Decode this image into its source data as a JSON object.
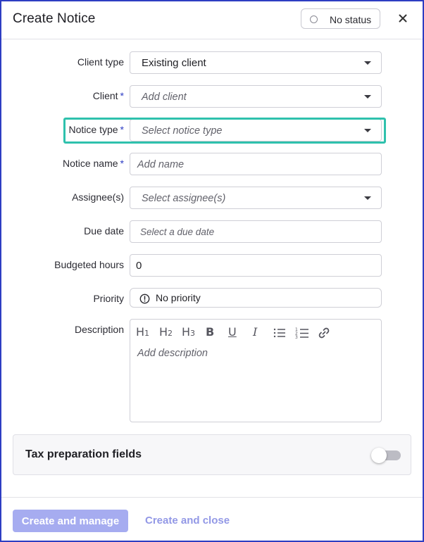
{
  "dialog": {
    "title": "Create Notice",
    "status_label": "No status",
    "close_icon": "close-icon"
  },
  "form": {
    "client_type": {
      "label": "Client type",
      "value": "Existing client"
    },
    "client": {
      "label": "Client",
      "required": "*",
      "placeholder": "Add client"
    },
    "notice_type": {
      "label": "Notice type",
      "required": "*",
      "placeholder": "Select notice type"
    },
    "notice_name": {
      "label": "Notice name",
      "required": "*",
      "placeholder": "Add name"
    },
    "assignees": {
      "label": "Assignee(s)",
      "placeholder": "Select assignee(s)"
    },
    "due_date": {
      "label": "Due date",
      "placeholder": "Select a due date"
    },
    "budgeted_hours": {
      "label": "Budgeted hours",
      "value": "0"
    },
    "priority": {
      "label": "Priority",
      "value": "No priority",
      "icon": "alert-circle-icon"
    },
    "description": {
      "label": "Description",
      "placeholder": "Add description",
      "toolbar": [
        "heading-1",
        "heading-2",
        "heading-3",
        "bold",
        "underline",
        "italic",
        "bullet-list",
        "numbered-list",
        "link"
      ]
    }
  },
  "tax_section": {
    "title": "Tax preparation fields",
    "toggle_on": false
  },
  "footer": {
    "primary_label": "Create and manage",
    "secondary_label": "Create and close"
  },
  "colors": {
    "accent": "#2d3dc2",
    "highlight": "#2fc1ad",
    "primary_button_disabled": "#a6acf0"
  }
}
